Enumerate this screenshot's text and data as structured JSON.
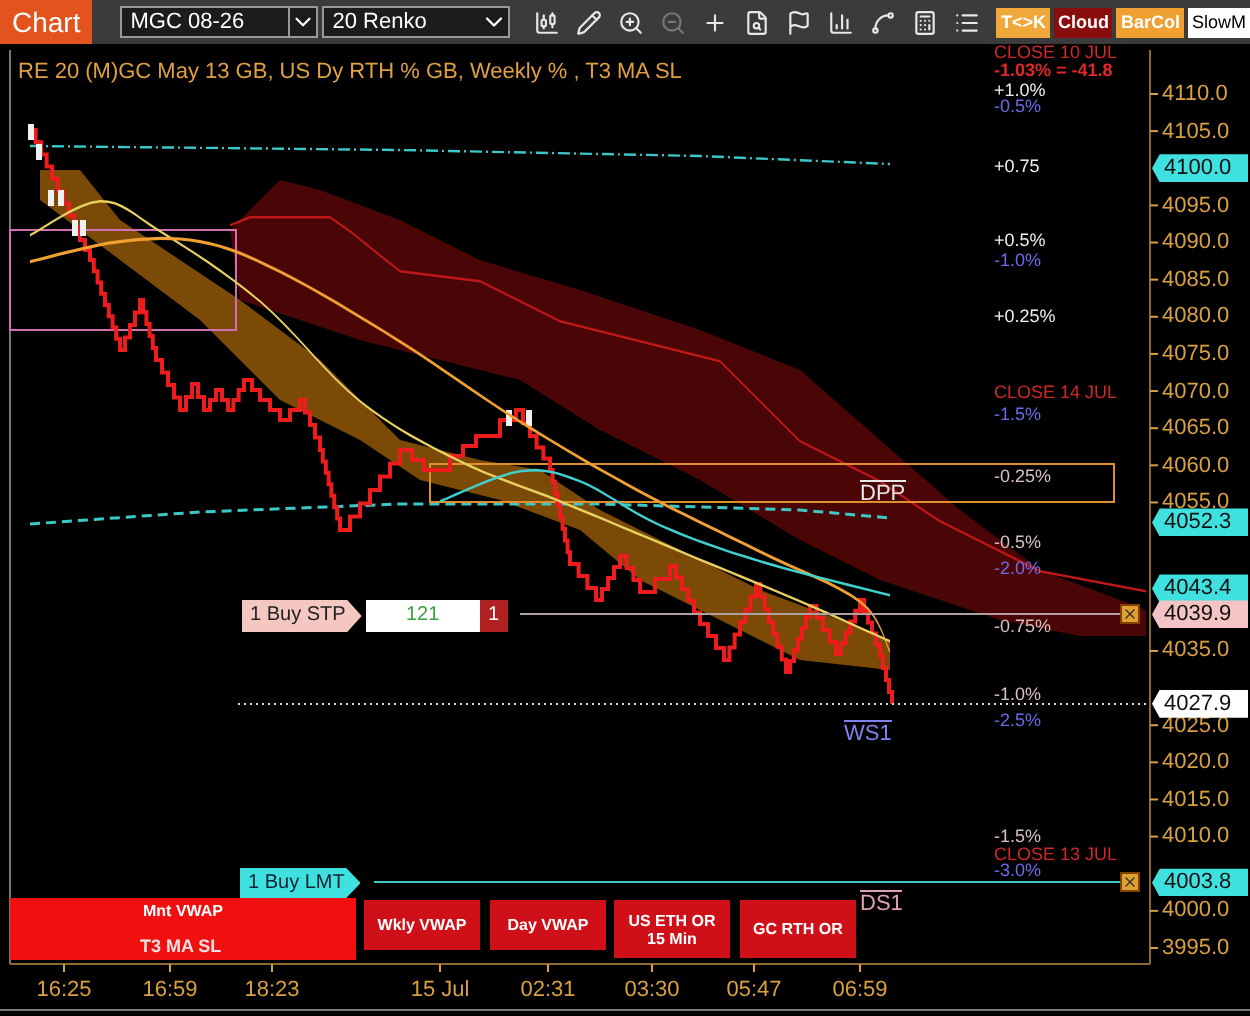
{
  "toolbar": {
    "chart_button": "Chart",
    "instrument": "MGC 08-26",
    "interval": "20 Renko",
    "tools": [
      {
        "disabled": false
      },
      {
        "disabled": false
      },
      {
        "disabled": false
      },
      {
        "disabled": true
      },
      {
        "disabled": false
      },
      {
        "disabled": false
      },
      {
        "disabled": false
      },
      {
        "disabled": false
      },
      {
        "disabled": false
      },
      {
        "disabled": false
      },
      {
        "disabled": false
      }
    ],
    "toggles": [
      {
        "label": "T<>K",
        "color": "#f0a83a"
      },
      {
        "label": "Cloud",
        "color": "#8a0d0d"
      },
      {
        "label": "BarCol",
        "color": "#f0a030"
      },
      {
        "label": "SlowM",
        "color": "#ffffff"
      }
    ]
  },
  "chart": {
    "title": "RE 20  (M)GC May 13 GB, US Dy RTH % GB, Weekly % , T3 MA SL",
    "labels": [
      {
        "text": "CLOSE 10 JUL",
        "kind": "close"
      },
      {
        "text": "-1.03% = -41.8",
        "kind": "change"
      },
      {
        "text": "+1.0%",
        "kind": "plus"
      },
      {
        "text": "-0.5%",
        "kind": "pct"
      },
      {
        "text": "+0.75",
        "kind": "plus"
      },
      {
        "text": "+0.5%",
        "kind": "plus"
      },
      {
        "text": "-1.0%",
        "kind": "pct"
      },
      {
        "text": "+0.25%",
        "kind": "plus"
      },
      {
        "text": "CLOSE 14 JUL",
        "kind": "close"
      },
      {
        "text": "-1.5%",
        "kind": "pct"
      },
      {
        "text": "-0.25%",
        "kind": "minus"
      },
      {
        "text": "-0.5%",
        "kind": "minus"
      },
      {
        "text": "-2.0%",
        "kind": "pct"
      },
      {
        "text": "-0.75%",
        "kind": "minus"
      },
      {
        "text": "-1.0%",
        "kind": "minus"
      },
      {
        "text": "-2.5%",
        "kind": "pct"
      },
      {
        "text": "-1.5%",
        "kind": "minus"
      },
      {
        "text": "CLOSE 13 JUL",
        "kind": "close"
      },
      {
        "text": "-3.0%",
        "kind": "pct"
      }
    ],
    "pivots": [
      {
        "text": "DPP",
        "kind": "daily"
      },
      {
        "text": "WS1",
        "kind": "weekly"
      },
      {
        "text": "DS1",
        "kind": "support"
      }
    ],
    "orders": [
      {
        "label": "1 Buy STP",
        "kind": "stop",
        "quantity": "121",
        "count": "1"
      },
      {
        "label": "1 Buy LMT",
        "kind": "limit"
      }
    ],
    "indicator_label": "T3 MA SL",
    "buttons": [
      "Mnt VWAP",
      "Wkly VWAP",
      "Day VWAP",
      "US ETH OR 15 Min",
      "GC RTH OR"
    ]
  },
  "price_axis": {
    "ticks": [
      "4110.0",
      "4105.0",
      "4095.0",
      "4090.0",
      "4085.0",
      "4080.0",
      "4075.0",
      "4070.0",
      "4065.0",
      "4060.0",
      "4055.0",
      "4035.0",
      "4025.0",
      "4020.0",
      "4015.0",
      "4010.0",
      "4000.0",
      "3995.0"
    ],
    "markers": [
      {
        "label": "4100.0",
        "color": "#3ee0e0"
      },
      {
        "label": "4052.3",
        "color": "#3ee0e0"
      },
      {
        "label": "4043.4",
        "color": "#3ee0e0"
      },
      {
        "label": "4039.9",
        "color": "#f4c4c4"
      },
      {
        "label": "4027.9",
        "color": "#ffffff"
      },
      {
        "label": "4003.8",
        "color": "#3ee0e0"
      }
    ]
  },
  "time_axis": [
    "16:25",
    "16:59",
    "18:23",
    "15 Jul",
    "02:31",
    "03:30",
    "05:47",
    "06:59"
  ]
}
